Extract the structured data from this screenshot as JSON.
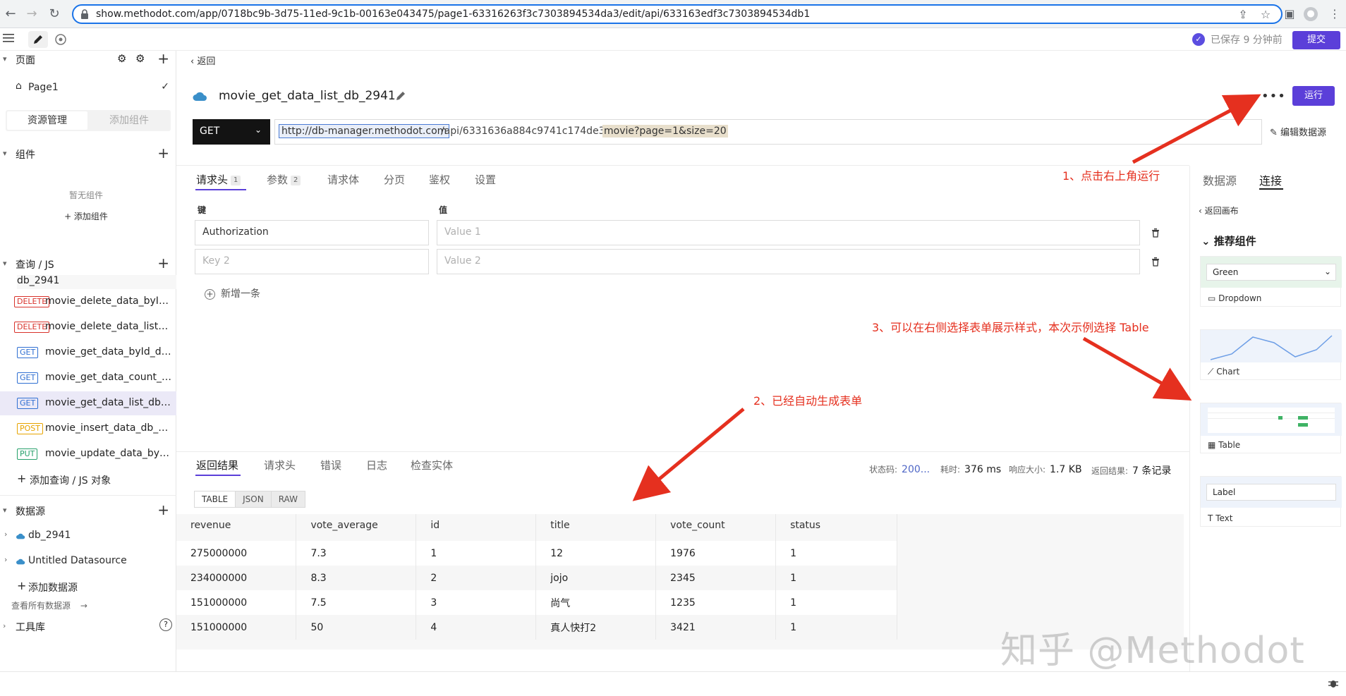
{
  "browser": {
    "url": "show.methodot.com/app/0718bc9b-3d75-11ed-9c1b-00163e043475/page1-63316263f3c7303894534da3/edit/api/633163edf3c7303894534db1"
  },
  "toolbar": {
    "saved_status": "已保存 9 分钟前",
    "submit_label": "提交"
  },
  "sidebar": {
    "pages_title": "页面",
    "page_name": "Page1",
    "seg_resource": "资源管理",
    "seg_add_component": "添加组件",
    "components_title": "组件",
    "no_components": "暂无组件",
    "add_component": "+ 添加组件",
    "queries_title": "查询 / JS",
    "query_group": "db_2941",
    "queries": [
      {
        "method": "DELETE",
        "name": "movie_delete_data_byId_..."
      },
      {
        "method": "DELETE",
        "name": "movie_delete_data_list_d..."
      },
      {
        "method": "GET",
        "name": "movie_get_data_byId_db..."
      },
      {
        "method": "GET",
        "name": "movie_get_data_count_d..."
      },
      {
        "method": "GET",
        "name": "movie_get_data_list_db_..."
      },
      {
        "method": "POST",
        "name": "movie_insert_data_db_2941"
      },
      {
        "method": "PUT",
        "name": "movie_update_data_byId..."
      }
    ],
    "add_query": "添加查询 / JS 对象",
    "datasources_title": "数据源",
    "datasources": [
      "db_2941",
      "Untitled Datasource"
    ],
    "add_datasource": "添加数据源",
    "view_all_datasources": "查看所有数据源",
    "toolbox_title": "工具库"
  },
  "editor": {
    "back_label": "返回",
    "api_name": "movie_get_data_list_db_2941",
    "run_label": "运行",
    "method": "GET",
    "url_base": "http://db-manager.methodot.com",
    "url_path": "/api/6331636a884c9741c174de38/",
    "url_query": "movie?page=1&size=20",
    "edit_datasource": "编辑数据源",
    "tabs": [
      {
        "label": "请求头",
        "badge": "1"
      },
      {
        "label": "参数",
        "badge": "2"
      },
      {
        "label": "请求体",
        "badge": ""
      },
      {
        "label": "分页",
        "badge": ""
      },
      {
        "label": "鉴权",
        "badge": ""
      },
      {
        "label": "设置",
        "badge": ""
      }
    ],
    "key_header": "键",
    "value_header": "值",
    "rows": [
      {
        "key": "Authorization",
        "value_placeholder": "Value 1"
      },
      {
        "key_placeholder": "Key 2",
        "value_placeholder": "Value 2"
      }
    ],
    "add_row": "新增一条"
  },
  "results": {
    "tabs": [
      "返回结果",
      "请求头",
      "错误",
      "日志",
      "检查实体"
    ],
    "status_label": "状态码:",
    "status_value": "200...",
    "time_label": "耗时:",
    "time_value": "376 ms",
    "size_label": "响应大小:",
    "size_value": "1.7 KB",
    "count_label": "返回结果:",
    "count_value": "7 条记录",
    "views": [
      "TABLE",
      "JSON",
      "RAW"
    ],
    "columns": [
      "revenue",
      "vote_average",
      "id",
      "title",
      "vote_count",
      "status"
    ],
    "rows": [
      [
        "275000000",
        "7.3",
        "1",
        "12",
        "1976",
        "1"
      ],
      [
        "234000000",
        "8.3",
        "2",
        "jojo",
        "2345",
        "1"
      ],
      [
        "151000000",
        "7.5",
        "3",
        "尚气",
        "1235",
        "1"
      ],
      [
        "151000000",
        "50",
        "4",
        "真人快打2",
        "3421",
        "1"
      ]
    ]
  },
  "right_panel": {
    "tab_datasource": "数据源",
    "tab_connect": "连接",
    "back_canvas": "返回画布",
    "recommended": "推荐组件",
    "dropdown_value": "Green",
    "widgets": [
      "Dropdown",
      "Chart",
      "Table",
      "Text"
    ],
    "text_preview": "Label"
  },
  "annotations": {
    "step1": "1、点击右上角运行",
    "step2": "2、已经自动生成表单",
    "step3": "3、可以在右侧选择表单展示样式，本次示例选择 Table"
  },
  "watermark": "知乎 @Methodot",
  "colors": {
    "accent": "#5b3fd9",
    "annotation": "#e5301f",
    "get": "#2f6fd2",
    "delete": "#d8322b",
    "post": "#e7a400",
    "put": "#26a06a"
  }
}
